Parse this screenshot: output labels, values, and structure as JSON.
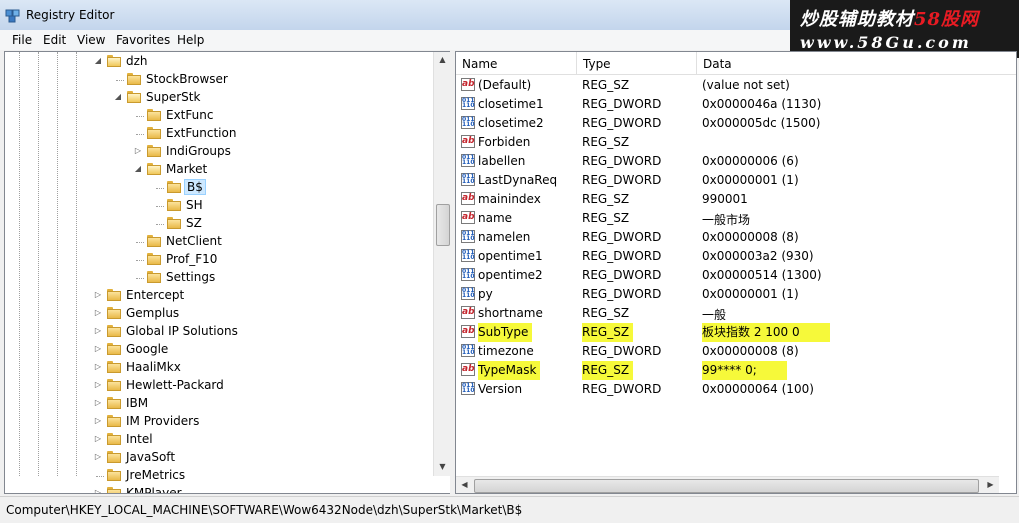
{
  "window": {
    "title": "Registry Editor"
  },
  "watermark": {
    "line1_a": "炒股辅助教材",
    "line1_b": "58股网",
    "line2": "www.58Gu.com"
  },
  "menu": [
    "File",
    "Edit",
    "View",
    "Favorites",
    "Help"
  ],
  "tree": [
    {
      "label": "dzh",
      "expanded": true
    },
    {
      "label": "StockBrowser"
    },
    {
      "label": "SuperStk",
      "expanded": true
    },
    {
      "label": "ExtFunc"
    },
    {
      "label": "ExtFunction"
    },
    {
      "label": "IndiGroups",
      "collapsed": true
    },
    {
      "label": "Market",
      "expanded": true
    },
    {
      "label": "B$",
      "selected": true
    },
    {
      "label": "SH"
    },
    {
      "label": "SZ"
    },
    {
      "label": "NetClient"
    },
    {
      "label": "Prof_F10"
    },
    {
      "label": "Settings"
    },
    {
      "label": "Entercept",
      "collapsed": true
    },
    {
      "label": "Gemplus",
      "collapsed": true
    },
    {
      "label": "Global IP Solutions",
      "collapsed": true
    },
    {
      "label": "Google",
      "collapsed": true
    },
    {
      "label": "HaaliMkx",
      "collapsed": true
    },
    {
      "label": "Hewlett-Packard",
      "collapsed": true
    },
    {
      "label": "IBM",
      "collapsed": true
    },
    {
      "label": "IM Providers",
      "collapsed": true
    },
    {
      "label": "Intel",
      "collapsed": true
    },
    {
      "label": "JavaSoft",
      "collapsed": true
    },
    {
      "label": "JreMetrics"
    },
    {
      "label": "KMPlayer",
      "collapsed": true
    }
  ],
  "columns": [
    "Name",
    "Type",
    "Data"
  ],
  "values": [
    {
      "name": "(Default)",
      "type": "REG_SZ",
      "data": "(value not set)",
      "kind": "sz"
    },
    {
      "name": "closetime1",
      "type": "REG_DWORD",
      "data": "0x0000046a (1130)",
      "kind": "dw"
    },
    {
      "name": "closetime2",
      "type": "REG_DWORD",
      "data": "0x000005dc (1500)",
      "kind": "dw"
    },
    {
      "name": "Forbiden",
      "type": "REG_SZ",
      "data": "",
      "kind": "sz"
    },
    {
      "name": "labellen",
      "type": "REG_DWORD",
      "data": "0x00000006 (6)",
      "kind": "dw"
    },
    {
      "name": "LastDynaReq",
      "type": "REG_DWORD",
      "data": "0x00000001 (1)",
      "kind": "dw"
    },
    {
      "name": "mainindex",
      "type": "REG_SZ",
      "data": "990001",
      "kind": "sz"
    },
    {
      "name": "name",
      "type": "REG_SZ",
      "data": "一般市场",
      "kind": "sz"
    },
    {
      "name": "namelen",
      "type": "REG_DWORD",
      "data": "0x00000008 (8)",
      "kind": "dw"
    },
    {
      "name": "opentime1",
      "type": "REG_DWORD",
      "data": "0x000003a2 (930)",
      "kind": "dw"
    },
    {
      "name": "opentime2",
      "type": "REG_DWORD",
      "data": "0x00000514 (1300)",
      "kind": "dw"
    },
    {
      "name": "py",
      "type": "REG_DWORD",
      "data": "0x00000001 (1)",
      "kind": "dw"
    },
    {
      "name": "shortname",
      "type": "REG_SZ",
      "data": "一般",
      "kind": "sz"
    },
    {
      "name": "SubType",
      "type": "REG_SZ",
      "data": "板块指数 2 100 0",
      "kind": "sz",
      "highlight": true
    },
    {
      "name": "timezone",
      "type": "REG_DWORD",
      "data": "0x00000008 (8)",
      "kind": "dw"
    },
    {
      "name": "TypeMask",
      "type": "REG_SZ",
      "data": "99**** 0;",
      "kind": "sz",
      "highlight": true
    },
    {
      "name": "Version",
      "type": "REG_DWORD",
      "data": "0x00000064 (100)",
      "kind": "dw"
    }
  ],
  "status": {
    "path": "Computer\\HKEY_LOCAL_MACHINE\\SOFTWARE\\Wow6432Node\\dzh\\SuperStk\\Market\\B$"
  },
  "colors": {
    "highlight": "#f6f93a",
    "selection": "#cde8ff"
  },
  "icons": {
    "app": "registry-editor-icon",
    "string_value": "reg-sz-icon",
    "dword_value": "reg-dword-icon",
    "folder": "folder-icon"
  }
}
